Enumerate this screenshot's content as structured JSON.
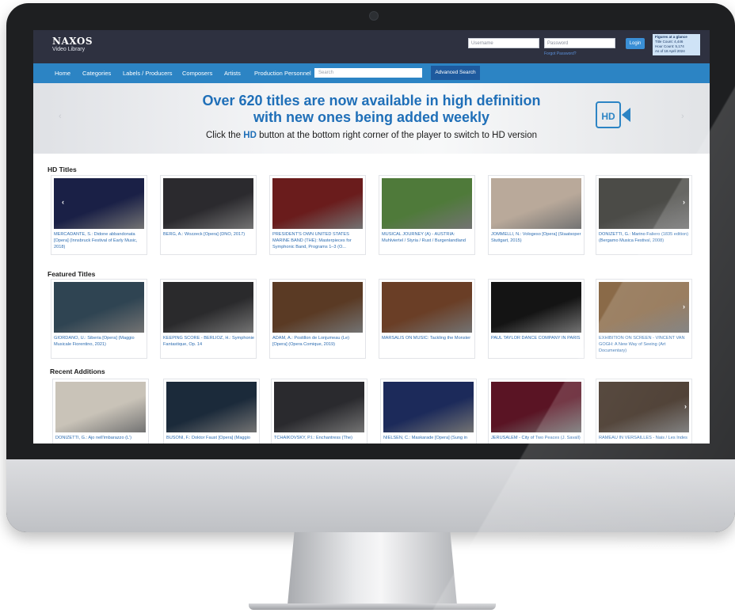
{
  "header": {
    "logo_line1": "NAXOS",
    "logo_line2": "Video Library",
    "username_placeholder": "Username",
    "password_placeholder": "Password",
    "forgot_password": "Forgot Password?",
    "login_label": "Login",
    "glance": {
      "title": "Figures at a glance",
      "line1": "Title Count: 4,446",
      "line2": "Hour Count: 5,174",
      "line3": "As of 18 April 2024"
    }
  },
  "nav": {
    "items": [
      "Home",
      "Categories",
      "Labels / Producers",
      "Composers",
      "Artists",
      "Production Personnel"
    ],
    "search_placeholder": "Search",
    "advanced_search": "Advanced Search"
  },
  "banner": {
    "line1": "Over 620 titles are now available in high definition",
    "line2": "with new ones being added weekly",
    "line3_pre": "Click the ",
    "line3_hd": "HD",
    "line3_post": " button at the bottom right corner of the player to switch to HD version",
    "hd_logo": "HD",
    "prev_arrow": "‹",
    "next_arrow": "›"
  },
  "sections": [
    {
      "title": "HD Titles",
      "items": [
        {
          "caption": "MERCADANTE, S.: Didone abbandonata [Opera] (Innsbruck Festival of Early Music, 2018)",
          "thumb_color": "#1a2046"
        },
        {
          "caption": "BERG, A.: Wozzeck [Opera] (DNO, 2017)",
          "thumb_color": "#2b2a2e"
        },
        {
          "caption": "PRESIDENT'S OWN UNITED STATES MARINE BAND (THE): Masterpieces for Symphonic Band, Programs 1–3 (O...",
          "thumb_color": "#6a1c1c"
        },
        {
          "caption": "MUSICAL JOURNEY (A) - AUSTRIA: Muhlviertel / Styria / Rust / Burgenlandland",
          "thumb_color": "#4f7a3a"
        },
        {
          "caption": "JOMMELLI, N.: Vologeso [Opera] (Staatsoper Stuttgart, 2015)",
          "thumb_color": "#b9a99a"
        },
        {
          "caption": "DONIZETTI, G.: Marino Faliero (1835 edition) (Bergamo Musica Festival, 2008)",
          "thumb_color": "#4b4b47"
        }
      ]
    },
    {
      "title": "Featured Titles",
      "items": [
        {
          "caption": "GIORDANO, U.: Siberia [Opera] (Maggio Musicale Fiorentino, 2021)",
          "thumb_color": "#2f4452"
        },
        {
          "caption": "KEEPING SCORE - BERLIOZ, H.: Symphonie Fantastique, Op. 14",
          "thumb_color": "#2a2a2c"
        },
        {
          "caption": "ADAM, A.: Postillon de Lonjumeau (Le) [Opera] (Opera Comique, 2019)",
          "thumb_color": "#5a3a24"
        },
        {
          "caption": "MARSALIS ON MUSIC: Tackling the Monster",
          "thumb_color": "#6a3e26"
        },
        {
          "caption": "PAUL TAYLOR DANCE COMPANY IN PARIS",
          "thumb_color": "#141414"
        },
        {
          "caption": "EXHIBITION ON SCREEN - VINCENT VAN GOGH: A New Way of Seeing (Art Documentary)",
          "thumb_color": "#8a6a48"
        }
      ]
    },
    {
      "title": "Recent Additions",
      "items": [
        {
          "caption": "DONIZETTI, G.: Ajo nell'imbarazzo (L')",
          "thumb_color": "#c9c3b8"
        },
        {
          "caption": "BUSONI, F.: Doktor Faust [Opera] (Maggio",
          "thumb_color": "#1b2a3a"
        },
        {
          "caption": "TCHAIKOVSKY, P.I.: Enchantress (The)",
          "thumb_color": "#2a2a2e"
        },
        {
          "caption": "NIELSEN, C.: Maskarade [Opera] (Sung in",
          "thumb_color": "#1c2a5a"
        },
        {
          "caption": "JERUSALEM - City of Two Peaces (J. Savall)",
          "thumb_color": "#5a1424"
        },
        {
          "caption": "RAMEAU IN VERSAILLES - Nais / Les Indes",
          "thumb_color": "#3a2a1e"
        }
      ]
    }
  ],
  "colors": {
    "header_bg": "#2e3140",
    "nav_bg": "#2c84c4",
    "accent": "#1f6fb8",
    "link": "#2c6cb0"
  }
}
